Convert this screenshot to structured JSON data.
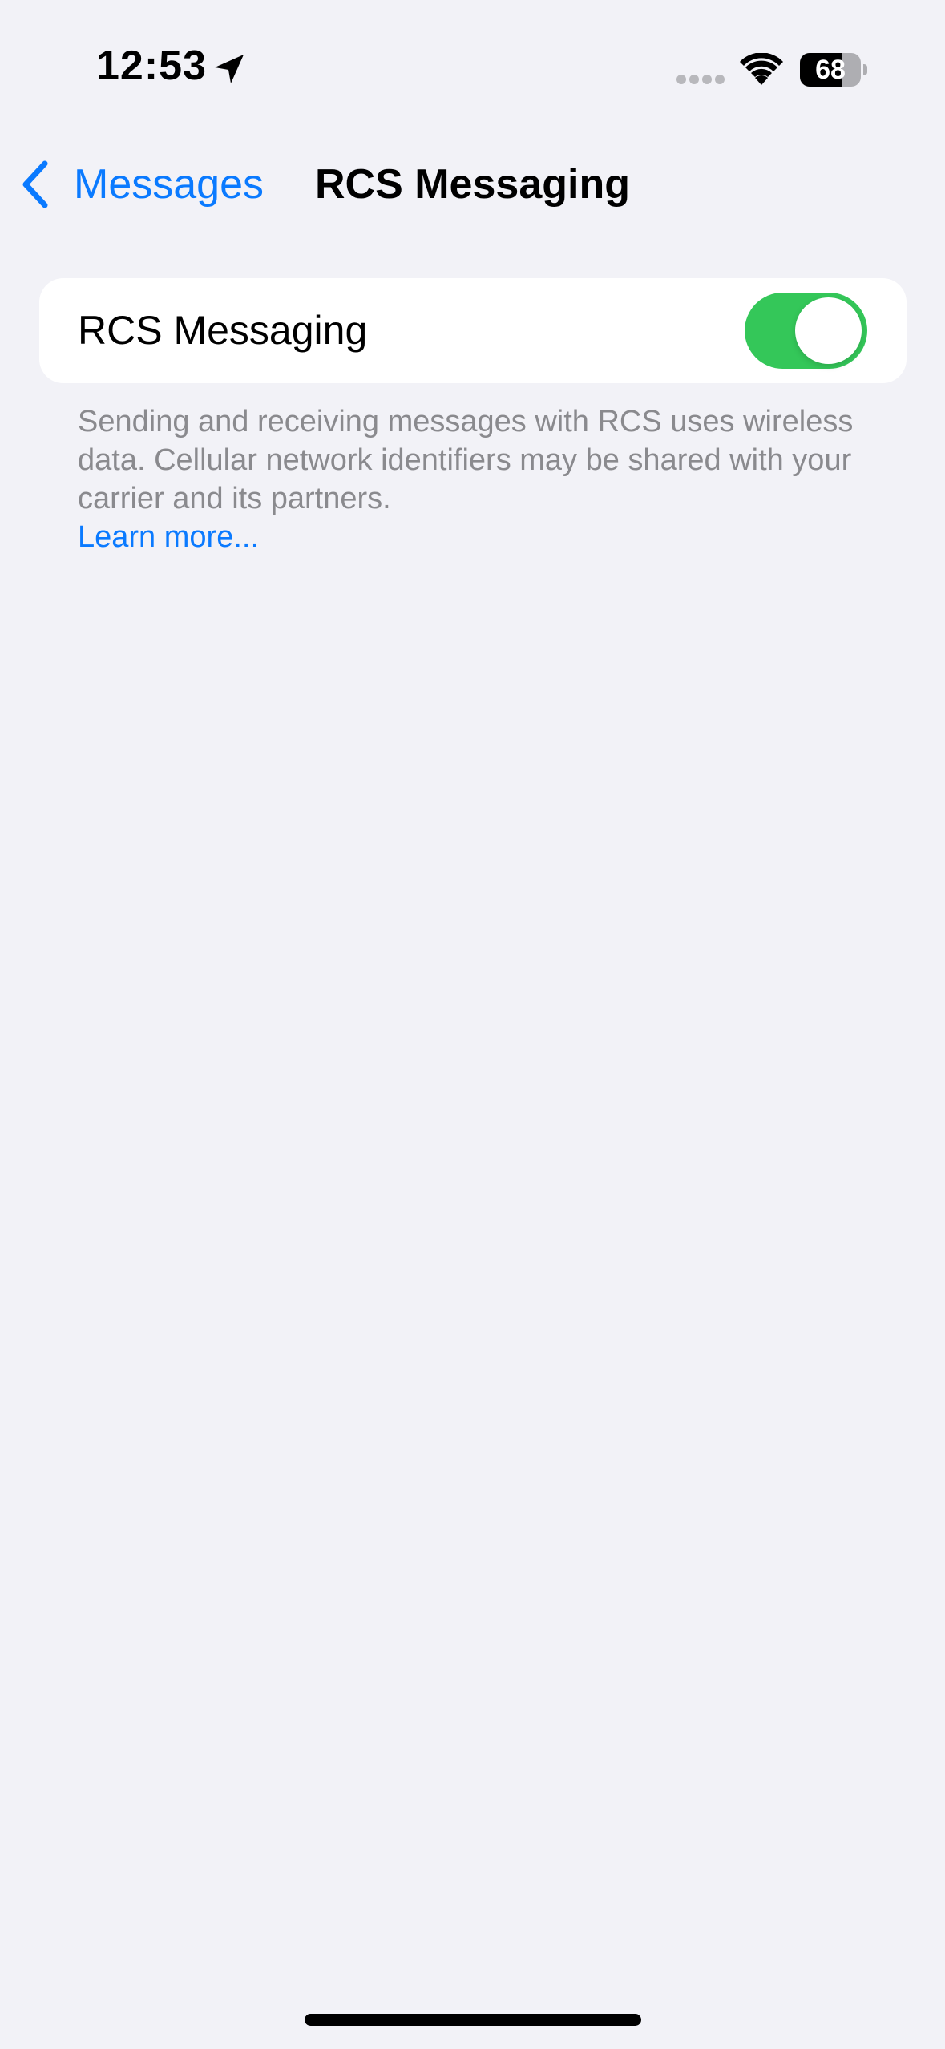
{
  "status_bar": {
    "time": "12:53",
    "battery_level": "68",
    "battery_fraction": 0.68
  },
  "icons": {
    "location": "location-arrow-icon",
    "signal": "cellular-signal-icon",
    "wifi": "wifi-icon",
    "back": "chevron-left-icon"
  },
  "nav": {
    "back_label": "Messages",
    "title": "RCS Messaging"
  },
  "settings": {
    "rcs_label": "RCS Messaging",
    "rcs_enabled": true,
    "footer_text": "Sending and receiving messages with RCS uses wireless data. Cellular network identifiers may be shared with your carrier and its partners.",
    "learn_more": "Learn more..."
  },
  "colors": {
    "accent": "#0a7aff",
    "toggle_on": "#34c759",
    "background": "#f2f2f7"
  }
}
